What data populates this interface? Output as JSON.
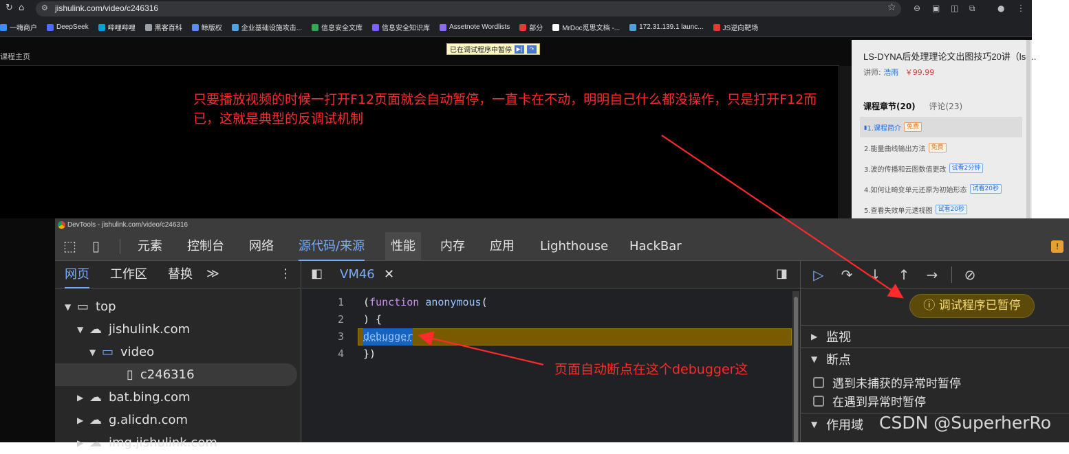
{
  "browser": {
    "url": "jishulink.com/video/c246316",
    "bookmarks": [
      {
        "label": "一嗨商户",
        "color": "#3d8bfd"
      },
      {
        "label": "DeepSeek",
        "color": "#4d6bfe"
      },
      {
        "label": "哔哩哔哩",
        "color": "#00a1d6"
      },
      {
        "label": "黑客百科",
        "color": "#9aa0a6"
      },
      {
        "label": "鲸版权",
        "color": "#5b8def"
      },
      {
        "label": "企业基础设施攻击...",
        "color": "#4fa3e0"
      },
      {
        "label": "信息安全文库",
        "color": "#34a853"
      },
      {
        "label": "信息安全知识库",
        "color": "#7b61ff"
      },
      {
        "label": "Assetnote Wordlists",
        "color": "#8e6cef"
      },
      {
        "label": "部分",
        "color": "#e53935"
      },
      {
        "label": "MrDoc觅思文档 -...",
        "color": "#ffffff"
      },
      {
        "label": "172.31.139.1 launc...",
        "color": "#4fa3e0"
      },
      {
        "label": "JS逆向靶场",
        "color": "#e53935"
      }
    ]
  },
  "page": {
    "breadcrumb": "课程主页",
    "paused_badge": "已在调试程序中暂停",
    "annotation_top": "只要播放视频的时候一打开F12页面就会自动暂停，一直卡在不动，明明自己什么都没操作，只是打开F12而已，这就是典型的反调试机制"
  },
  "course": {
    "title": "LS-DYNA后处理理论文出图技巧20讲（ls-...",
    "lecturer_label": "讲师:",
    "lecturer_name": "浩雨",
    "price": "￥99.99",
    "tab_chapters": "课程章节(20)",
    "tab_comments": "评论(23)",
    "chapters": [
      {
        "label": "1.课程简介",
        "tag": "免费",
        "tag_type": "free",
        "active": true
      },
      {
        "label": "2.能量曲线输出方法",
        "tag": "免费",
        "tag_type": "free",
        "active": false
      },
      {
        "label": "3.波的传播和云图数值更改",
        "tag": "试看2分钟",
        "tag_type": "trial",
        "active": false
      },
      {
        "label": "4.如何让畸变单元还原为初始形态",
        "tag": "试看20秒",
        "tag_type": "trial",
        "active": false
      },
      {
        "label": "5.查看失效单元透视图",
        "tag": "试看20秒",
        "tag_type": "trial",
        "active": false
      }
    ]
  },
  "devtools": {
    "title": "DevTools - jishulink.com/video/c246316",
    "tabs": [
      "元素",
      "控制台",
      "网络",
      "源代码/来源",
      "性能",
      "内存",
      "应用",
      "Lighthouse",
      "HackBar"
    ],
    "selected_tab": "源代码/来源",
    "nav_tabs": [
      "网页",
      "工作区",
      "替换"
    ],
    "tree": [
      {
        "label": "top",
        "icon": "frame-icon"
      },
      {
        "label": "jishulink.com",
        "icon": "cloud-icon"
      },
      {
        "label": "video",
        "icon": "folder-icon"
      },
      {
        "label": "c246316",
        "icon": "file-icon"
      },
      {
        "label": "bat.bing.com",
        "icon": "cloud-icon"
      },
      {
        "label": "g.alicdn.com",
        "icon": "cloud-icon"
      },
      {
        "label": "img.jishulink.com",
        "icon": "cloud-icon"
      }
    ],
    "file_tab": "VM46",
    "code": {
      "line_numbers": [
        "1",
        "2",
        "3",
        "4"
      ],
      "kw_function": "function",
      "fn_name": "anonymous",
      "paren_open": "(",
      "line2": ") {",
      "debugger": "debugger",
      "line4": "})"
    },
    "paused_status": "调试程序已暂停",
    "sections": {
      "watch": "监视",
      "breakpoints": "断点",
      "scope": "作用域"
    },
    "checkboxes": [
      "遇到未捕获的异常时暂停",
      "在遇到异常时暂停"
    ]
  },
  "annotations": {
    "bottom": "页面自动断点在这个debugger这",
    "watermark": "CSDN @SuperherRo"
  },
  "colors": {
    "annotation": "#ff2a2a",
    "accent": "#7cacf8",
    "paused_line": "#7a5a00"
  }
}
